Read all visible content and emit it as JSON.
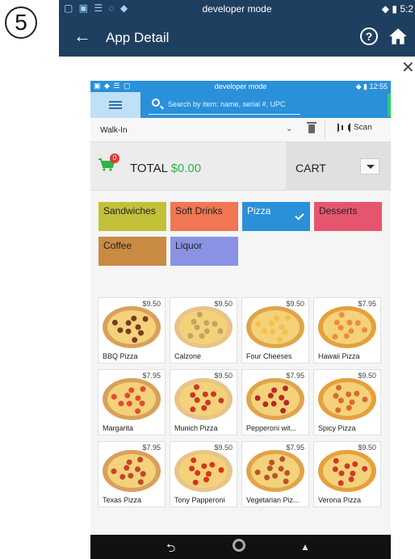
{
  "step_number": "5",
  "outer_status": {
    "title": "developer mode",
    "time": "5:2"
  },
  "appbar": {
    "title": "App Detail"
  },
  "device_status": {
    "title": "developer mode",
    "time": "12:55"
  },
  "search": {
    "placeholder": "Search by item: name, serial #, UPC"
  },
  "customer": {
    "selected": "Walk-In",
    "scan_label": "Scan"
  },
  "cart": {
    "badge": "0",
    "total_label": "TOTAL",
    "total_value": "$0.00",
    "cart_label": "CART"
  },
  "categories": [
    {
      "label": "Sandwiches",
      "color": "#c3c03a"
    },
    {
      "label": "Soft Drinks",
      "color": "#f07654"
    },
    {
      "label": "Pizza",
      "color": "#2a90d9",
      "active": true
    },
    {
      "label": "Desserts",
      "color": "#e5566e"
    },
    {
      "label": "Coffee",
      "color": "#c98a44"
    },
    {
      "label": "Liquor",
      "color": "#8a93e3"
    }
  ],
  "products": [
    {
      "name": "BBQ Pizza",
      "price": "$9.50"
    },
    {
      "name": "Calzone",
      "price": "$9.50"
    },
    {
      "name": "Four Cheeses",
      "price": "$9.50"
    },
    {
      "name": "Hawaii Pizza",
      "price": "$7.95"
    },
    {
      "name": "Margarita",
      "price": "$7.95"
    },
    {
      "name": "Munich Pizza",
      "price": "$9.50"
    },
    {
      "name": "Pepperoni wit...",
      "price": "$7.95"
    },
    {
      "name": "Spicy Pizza",
      "price": "$9.50"
    },
    {
      "name": "Texas Pizza",
      "price": "$7.95"
    },
    {
      "name": "Tony Papperoni",
      "price": "$9.50"
    },
    {
      "name": "Vegetarian Piz...",
      "price": "$7.95"
    },
    {
      "name": "Verona Pizza",
      "price": "$9.50"
    }
  ]
}
